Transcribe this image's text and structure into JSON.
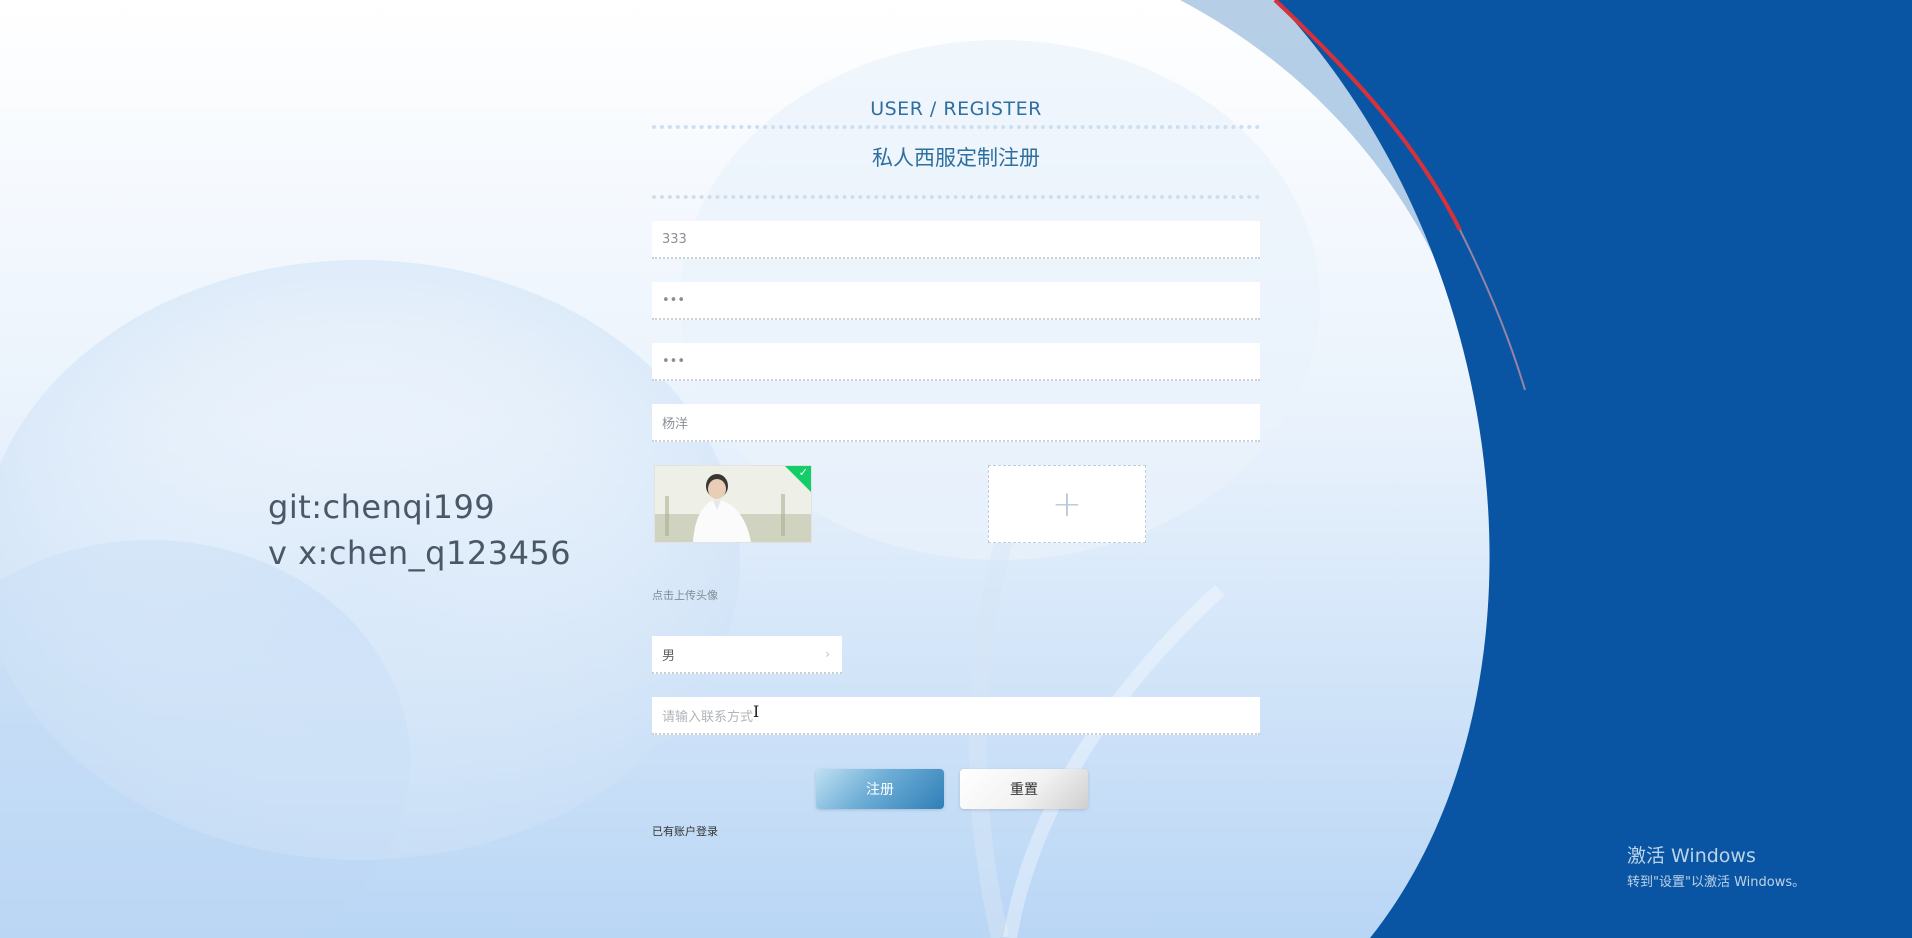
{
  "watermark": {
    "line1": "git:chenqi199",
    "line2": "v x:chen_q123456"
  },
  "form": {
    "title_en": "USER / REGISTER",
    "title_cn": "私人西服定制注册",
    "fields": {
      "account": {
        "value": "333"
      },
      "password": {
        "value": "•••"
      },
      "confirm_password": {
        "value": "•••"
      },
      "name": {
        "value": "杨洋"
      },
      "contact": {
        "placeholder": "请输入联系方式"
      }
    },
    "upload": {
      "plus": "+",
      "tip": "点击上传头像",
      "check": "✓"
    },
    "gender": {
      "selected": "男",
      "arrow": "›"
    },
    "buttons": {
      "register": "注册",
      "reset": "重置"
    },
    "login_link": "已有账户登录"
  },
  "windows_activation": {
    "title": "激活 Windows",
    "subtitle": "转到\"设置\"以激活 Windows。"
  },
  "colors": {
    "title": "#2f6fa0",
    "right_panel": "#0a55a3",
    "accent_stripe": "#d9313a",
    "upload_check": "#13ce66"
  }
}
